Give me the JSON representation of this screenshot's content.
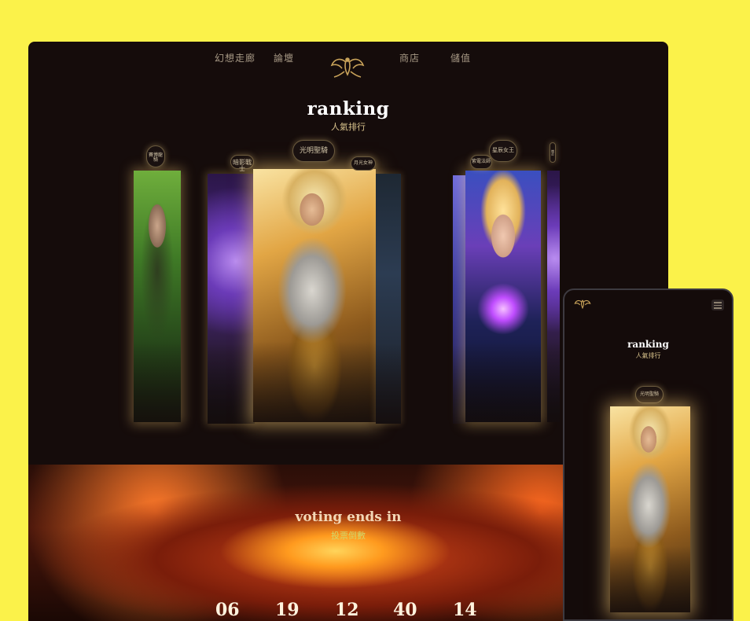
{
  "desktop": {
    "nav": {
      "items": [
        "幻想走廊",
        "論壇",
        "商店",
        "儲值"
      ]
    },
    "ranking": {
      "title": "ranking",
      "subtitle": "人氣排行"
    },
    "cards": {
      "pills": [
        "賽博龍騎",
        "暗影戰士",
        "光明聖騎",
        "月光女神",
        "紫電法師",
        "星辰女王",
        "熾炎"
      ]
    },
    "voting": {
      "title": "voting ends in",
      "subtitle": "投票倒數",
      "countdown": [
        "06",
        "19",
        "12",
        "40",
        "14"
      ]
    }
  },
  "mobile": {
    "ranking": {
      "title": "ranking",
      "subtitle": "人氣排行"
    },
    "pill": "光明聖騎"
  },
  "colors": {
    "background": "#fbf24a",
    "panel": "#150c0b",
    "gold": "#d9c38c",
    "glow": "#ffd278"
  },
  "icons": [
    "dragon-logo-icon",
    "hamburger-menu-icon"
  ]
}
